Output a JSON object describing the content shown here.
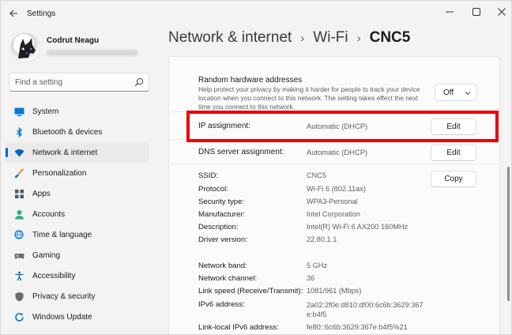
{
  "window": {
    "title": "Settings",
    "icons": {
      "back": "arrow-left-icon",
      "minimize": "minimize-icon",
      "maximize": "maximize-icon",
      "close": "close-icon"
    }
  },
  "user": {
    "name": "Codrut Neagu",
    "avatar_icon": "wolf-avatar"
  },
  "search": {
    "placeholder": "Find a setting",
    "icon": "search-icon"
  },
  "sidebar": {
    "active_index": 2,
    "accent": "#0067c0",
    "items": [
      {
        "label": "System",
        "icon": "monitor-icon",
        "color": "#0078d4"
      },
      {
        "label": "Bluetooth & devices",
        "icon": "bluetooth-icon",
        "color": "#0078d4"
      },
      {
        "label": "Network & internet",
        "icon": "wifi-icon",
        "color": "#0067c0"
      },
      {
        "label": "Personalization",
        "icon": "brush-icon",
        "color": "#e8912d"
      },
      {
        "label": "Apps",
        "icon": "apps-icon",
        "color": "#4a5a6a"
      },
      {
        "label": "Accounts",
        "icon": "person-icon",
        "color": "#2bb07f"
      },
      {
        "label": "Time & language",
        "icon": "globe-clock-icon",
        "color": "#0078d4"
      },
      {
        "label": "Gaming",
        "icon": "gamepad-icon",
        "color": "#6b6b6b"
      },
      {
        "label": "Accessibility",
        "icon": "accessibility-icon",
        "color": "#0067c0"
      },
      {
        "label": "Privacy & security",
        "icon": "shield-icon",
        "color": "#6b6b6b"
      },
      {
        "label": "Windows Update",
        "icon": "refresh-icon",
        "color": "#0078d4"
      }
    ]
  },
  "breadcrumb": {
    "items": [
      "Network & internet",
      "Wi-Fi"
    ],
    "current": "CNC5",
    "separator": "›"
  },
  "random_hw": {
    "title": "Random hardware addresses",
    "description": "Help protect your privacy by making it harder for people to track your device location when you connect to this network. The setting takes effect the next time you connect to this network.",
    "value": "Off"
  },
  "ip_assignment": {
    "label": "IP assignment:",
    "value": "Automatic (DHCP)",
    "button": "Edit"
  },
  "dns_assignment": {
    "label": "DNS server assignment:",
    "value": "Automatic (DHCP)",
    "button": "Edit"
  },
  "copy_button": "Copy",
  "properties": [
    {
      "label": "SSID:",
      "value": "CNC5"
    },
    {
      "label": "Protocol:",
      "value": "Wi-Fi 6 (802.11ax)"
    },
    {
      "label": "Security type:",
      "value": "WPA3-Personal"
    },
    {
      "label": "Manufacturer:",
      "value": "Intel Corporation"
    },
    {
      "label": "Description:",
      "value": "Intel(R) Wi-Fi 6 AX200 160MHz"
    },
    {
      "label": "Driver version:",
      "value": "22.80.1.1"
    }
  ],
  "properties2": [
    {
      "label": "Network band:",
      "value": "5 GHz"
    },
    {
      "label": "Network channel:",
      "value": "36"
    },
    {
      "label": "Link speed (Receive/Transmit):",
      "value": "1081/961 (Mbps)"
    },
    {
      "label": "IPv6 address:",
      "value": "2a02:2f0e:d810:df00:6c6b:3629:367e:b4f5"
    },
    {
      "label": "Link-local IPv6 address:",
      "value": "fe80::6c6b:3629:367e:b4f5%21"
    }
  ],
  "highlight_color": "#e8000b"
}
